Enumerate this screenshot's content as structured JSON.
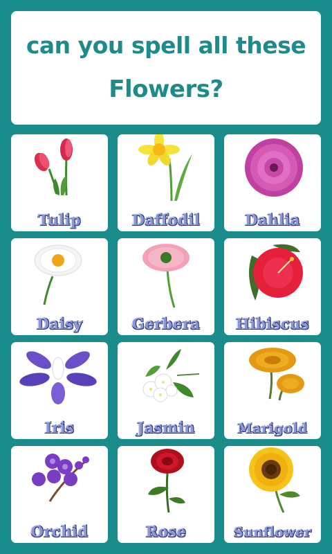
{
  "header": {
    "line1": "can you spell all these",
    "line2": "Flowers?"
  },
  "flowers": [
    {
      "label": "Tulip",
      "icon": "tulip-icon"
    },
    {
      "label": "Daffodil",
      "icon": "daffodil-icon"
    },
    {
      "label": "Dahlia",
      "icon": "dahlia-icon"
    },
    {
      "label": "Daisy",
      "icon": "daisy-icon"
    },
    {
      "label": "Gerbera",
      "icon": "gerbera-icon"
    },
    {
      "label": "Hibiscus",
      "icon": "hibiscus-icon"
    },
    {
      "label": "Iris",
      "icon": "iris-icon"
    },
    {
      "label": "Jasmin",
      "icon": "jasmin-icon"
    },
    {
      "label": "Marigold",
      "icon": "marigold-icon"
    },
    {
      "label": "Orchid",
      "icon": "orchid-icon"
    },
    {
      "label": "Rose",
      "icon": "rose-icon"
    },
    {
      "label": "Sunflower",
      "icon": "sunflower-icon"
    }
  ],
  "colors": {
    "background": "#1a8c8c",
    "title": "#1f8a8a",
    "label": "#8a97d6"
  }
}
